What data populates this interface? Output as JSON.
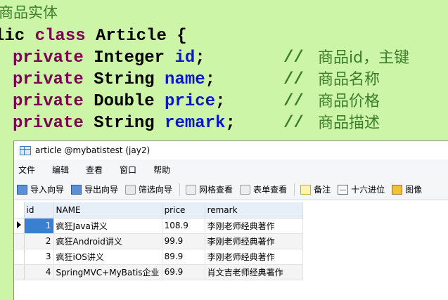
{
  "code": {
    "lines": [
      {
        "text": "商品实体"
      },
      {
        "pre": "lic ",
        "kw": "class",
        "post": " Article {"
      },
      {
        "kw": "private",
        "type": " Integer ",
        "field": "id",
        "end": ";",
        "comment": "//",
        "comment_cn": "商品id，主键"
      },
      {
        "kw": "private",
        "type": " String ",
        "field": "name",
        "end": ";",
        "comment": "//",
        "comment_cn": "商品名称"
      },
      {
        "kw": "private",
        "type": " Double ",
        "field": "price",
        "end": ";",
        "comment": "//",
        "comment_cn": "商品价格"
      },
      {
        "kw": "private",
        "type": " String ",
        "field": "remark",
        "end": ";",
        "comment": "//",
        "comment_cn": "商品描述"
      }
    ]
  },
  "window": {
    "title": "article @mybatistest (jay2)",
    "menu": [
      "文件",
      "编辑",
      "查看",
      "窗口",
      "帮助"
    ],
    "toolbar": [
      {
        "label": "导入向导",
        "icon": "import-icon"
      },
      {
        "label": "导出向导",
        "icon": "export-icon"
      },
      {
        "label": "筛选向导",
        "icon": "filter-icon"
      },
      {
        "label": "网格查看",
        "icon": "grid-view-icon"
      },
      {
        "label": "表单查看",
        "icon": "form-view-icon"
      },
      {
        "label": "备注",
        "icon": "note-icon"
      },
      {
        "label": "十六进位",
        "icon": "hex-icon"
      },
      {
        "label": "图像",
        "icon": "image-icon"
      }
    ],
    "grid": {
      "columns": [
        "id",
        "NAME",
        "price",
        "remark"
      ],
      "rows": [
        [
          "1",
          "疯狂Java讲义",
          "108.9",
          "李刚老师经典著作"
        ],
        [
          "2",
          "疯狂Android讲义",
          "99.9",
          "李刚老师经典著作"
        ],
        [
          "3",
          "疯狂iOS讲义",
          "89.9",
          "李刚老师经典著作"
        ],
        [
          "4",
          "SpringMVC+MyBatis企业",
          "69.9",
          "肖文吉老师经典著作"
        ]
      ]
    }
  },
  "colors": {
    "editor_bg": "#cdf5a8",
    "keyword": "#7b0052",
    "field": "#0b17c8",
    "comment": "#3a7d2c",
    "selection": "#3a7fd0"
  }
}
